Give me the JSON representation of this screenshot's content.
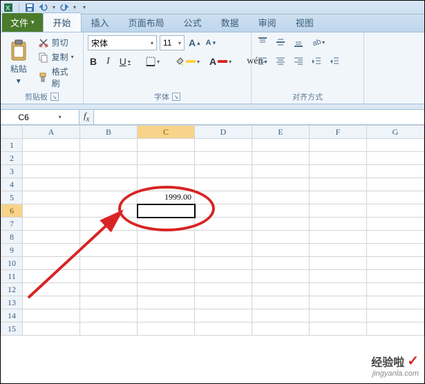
{
  "tabs": {
    "file": "文件",
    "home": "开始",
    "insert": "插入",
    "layout": "页面布局",
    "formulas": "公式",
    "data": "数据",
    "review": "审阅",
    "view": "视图"
  },
  "clipboard": {
    "paste": "粘贴",
    "cut": "剪切",
    "copy": "复制",
    "format_painter": "格式刷",
    "group_label": "剪贴板"
  },
  "font": {
    "name": "宋体",
    "size": "11",
    "group_label": "字体",
    "bold": "B",
    "italic": "I",
    "underline": "U",
    "inc_label": "A",
    "dec_label": "A"
  },
  "align": {
    "group_label": "对齐方式"
  },
  "namebox": "C6",
  "cells": {
    "C5": "1999.00"
  },
  "columns": [
    "A",
    "B",
    "C",
    "D",
    "E",
    "F",
    "G"
  ],
  "rows": [
    "1",
    "2",
    "3",
    "4",
    "5",
    "6",
    "7",
    "8",
    "9",
    "10",
    "11",
    "12",
    "13",
    "14",
    "15"
  ],
  "watermark": {
    "text": "经验啦",
    "url": "jingyanla.com"
  },
  "chart_data": null
}
